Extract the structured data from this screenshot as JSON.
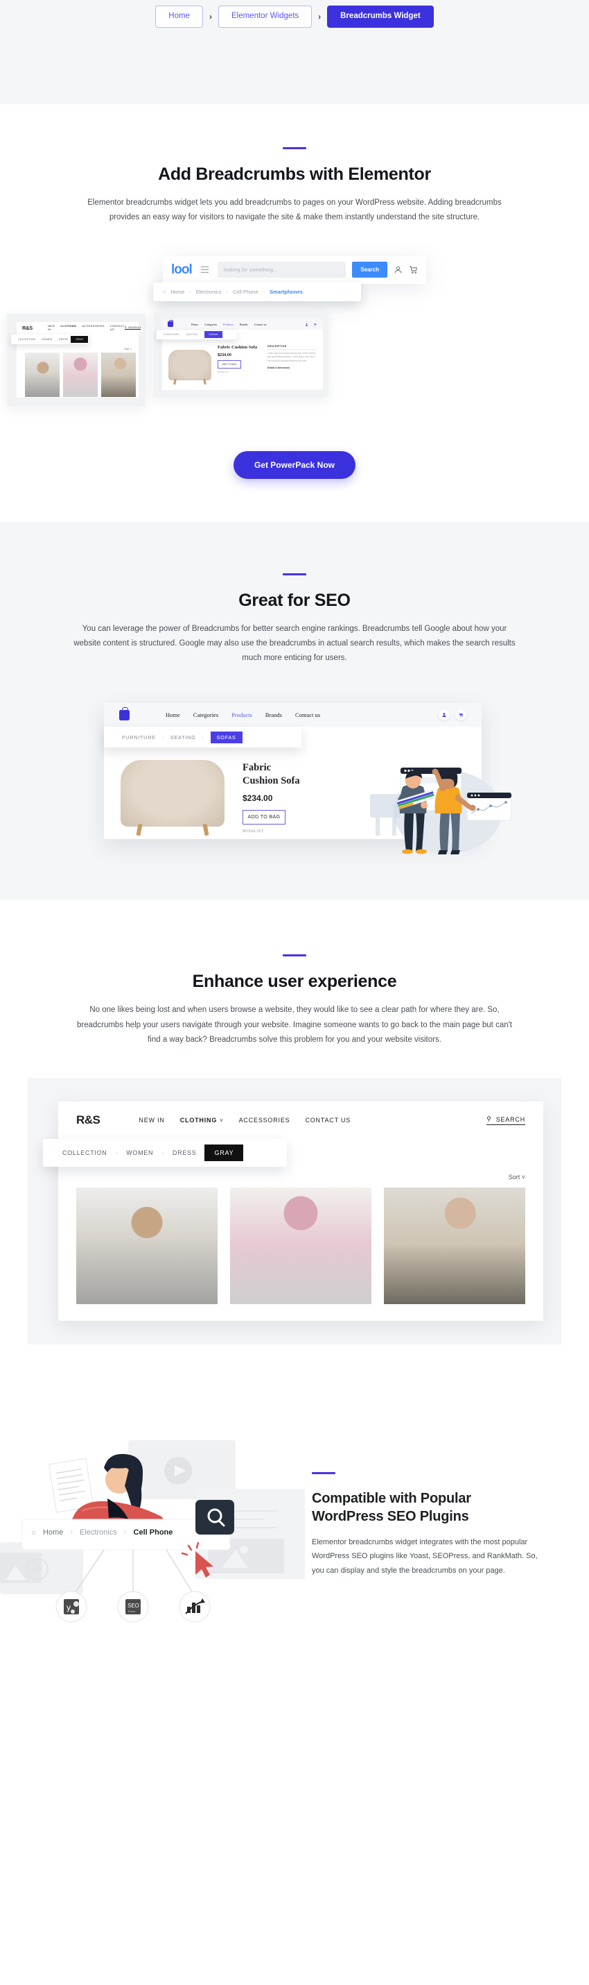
{
  "breadcrumb_nav": {
    "items": [
      {
        "label": "Home",
        "active": false
      },
      {
        "label": "Elementor Widgets",
        "active": false
      },
      {
        "label": "Breadcrumbs Widget",
        "active": true
      }
    ],
    "separator": "›"
  },
  "accent_color": "#4b32e0",
  "sections": {
    "add_breadcrumbs": {
      "title": "Add Breadcrumbs with Elementor",
      "description": "Elementor breadcrumbs widget lets you add breadcrumbs to pages on your WordPress website. Adding breadcrumbs provides an easy way for visitors to navigate the site & make them instantly understand the site structure.",
      "cta_label": "Get PowerPack Now",
      "lool_mock": {
        "logo": "lool",
        "search_placeholder": "looking for something...",
        "search_button": "Search",
        "breadcrumbs": [
          "Home",
          "Electronics",
          "Cell Phone",
          "Smartphones"
        ],
        "breadcrumb_active": "Smartphones"
      },
      "rs_mock": {
        "logo": "R&S",
        "nav": [
          "NEW IN",
          "CLOTHING",
          "ACCESSORIES",
          "CONTACT US"
        ],
        "search_label": "SEARCH",
        "breadcrumbs": [
          "COLLECTION",
          "WOMEN",
          "DRESS"
        ],
        "breadcrumb_active": "GRAY",
        "sort_label": "Sort"
      },
      "furniture_mock": {
        "nav": [
          "Home",
          "Categories",
          "Products",
          "Brands",
          "Contact us"
        ],
        "nav_active": "Products",
        "breadcrumbs": [
          "FURNITURE",
          "SEATING"
        ],
        "breadcrumb_active": "SOFAS",
        "product_title": "Fabric Cushion Sofa",
        "product_price": "$234.00",
        "add_button": "ADD TO BAG",
        "wishlist": "WISHLIST",
        "description_heading": "DESCRIPTION",
        "description_body": "Lorem Ipsum is simply dummy text of the printing and typesetting industry. Lorem Ipsum has been the industry's standard dummy text ever",
        "details_link": "Details & dimensions"
      }
    },
    "seo": {
      "title": "Great for SEO",
      "description": "You can leverage the power of Breadcrumbs for better search engine rankings. Breadcrumbs tell Google about how your website content is structured. Google may also use the breadcrumbs in actual search results, which makes the search results much more enticing for users.",
      "mock": {
        "nav": [
          "Home",
          "Categories",
          "Products",
          "Brands",
          "Contact us"
        ],
        "nav_active": "Products",
        "breadcrumbs": [
          "FURNITURE",
          "SEATING"
        ],
        "breadcrumb_active": "SOFAS",
        "product_title_line1": "Fabric",
        "product_title_line2": "Cushion Sofa",
        "product_price": "$234.00",
        "add_button": "ADD TO BAG",
        "wishlist": "WISHLIST"
      }
    },
    "ux": {
      "title": "Enhance user experience",
      "description": "No one likes being lost and when users browse a website, they would like to see a clear path for where they are. So, breadcrumbs help your users navigate through your website. Imagine someone wants to go back to the main page but can't find a way back? Breadcrumbs solve this problem for you and your website visitors.",
      "mock": {
        "logo": "R&S",
        "nav": [
          "NEW IN",
          "CLOTHING",
          "ACCESSORIES",
          "CONTACT US"
        ],
        "nav_active": "CLOTHING",
        "search_label": "SEARCH",
        "breadcrumbs": [
          "COLLECTION",
          "WOMEN",
          "DRESS"
        ],
        "breadcrumb_active": "GRAY",
        "sort_label": "Sort"
      }
    },
    "plugins": {
      "title_line1": "Compatible with Popular",
      "title_line2": "WordPress SEO Plugins",
      "description": "Elementor breadcrumbs widget integrates with the most popular WordPress SEO plugins like Yoast, SEOPress, and RankMath. So, you can display and style the breadcrumbs on your page.",
      "illustration": {
        "breadcrumbs": [
          "Home",
          "Electronics"
        ],
        "breadcrumb_active": "Cell Phone",
        "plugin_icons": [
          "yoast-seo-icon",
          "seopress-icon",
          "rankmath-icon"
        ]
      }
    }
  }
}
